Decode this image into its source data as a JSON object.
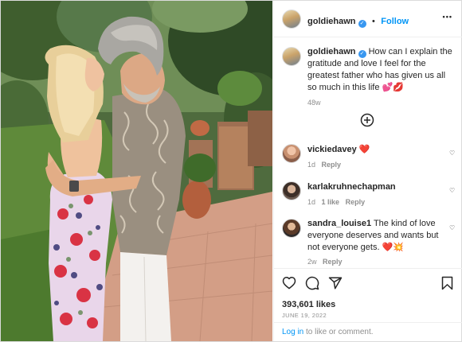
{
  "header": {
    "username": "goldiehawn",
    "follow_label": "Follow",
    "separator": "•",
    "more_label": "•••"
  },
  "caption": {
    "username": "goldiehawn",
    "text": "How can I explain the gratitude and love I feel for the greatest father who has given us all so much in this life 💕💋",
    "age": "48w"
  },
  "load_more": {
    "icon": "plus-circle-icon"
  },
  "comments": [
    {
      "username": "vickiedavey",
      "text": "❤️",
      "age": "1d",
      "likes": "",
      "reply_label": "Reply"
    },
    {
      "username": "karlakruhnechapman",
      "text": "",
      "age": "1d",
      "likes": "1 like",
      "reply_label": "Reply"
    },
    {
      "username": "sandra_louise1",
      "text": "The kind of love everyone deserves and wants but not everyone gets. ❤️💥",
      "age": "2w",
      "likes": "",
      "reply_label": "Reply"
    }
  ],
  "actions": {
    "like": "heart-icon",
    "comment": "comment-icon",
    "share": "share-icon",
    "save": "bookmark-icon"
  },
  "post": {
    "likes": "393,601 likes",
    "date": "JUNE 19, 2022"
  },
  "login": {
    "link": "Log in",
    "rest": " to like or comment."
  },
  "colors": {
    "accent": "#0095f6",
    "verified": "#3897f0",
    "heart": "#ed4956"
  }
}
